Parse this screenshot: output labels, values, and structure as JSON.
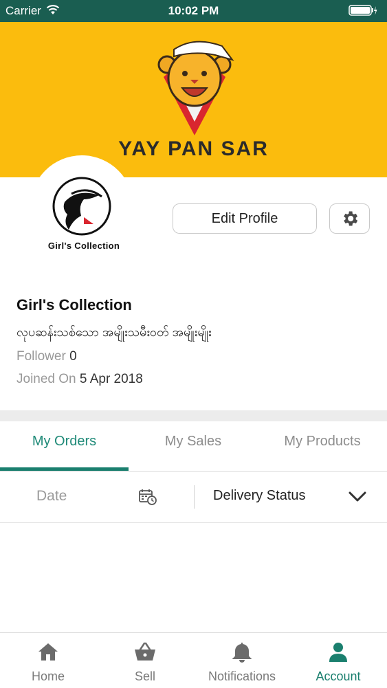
{
  "status_bar": {
    "carrier": "Carrier",
    "time": "10:02 PM"
  },
  "banner": {
    "brand": "YAY PAN SAR",
    "background": "#fbbc0d"
  },
  "profile": {
    "avatar_caption": "Girl's Collection",
    "edit_label": "Edit Profile",
    "shop_name": "Girl's Collection",
    "description": "လုပဆန်းသစ်သော အမျိုးသမီးဝတ် အမျိုးမျိုး",
    "follower_label": "Follower",
    "follower_count": "0",
    "joined_label": "Joined On",
    "joined_date": "5 Apr 2018"
  },
  "tabs": [
    {
      "label": "My Orders",
      "active": true
    },
    {
      "label": "My Sales",
      "active": false
    },
    {
      "label": "My Products",
      "active": false
    }
  ],
  "filter": {
    "date_label": "Date",
    "status_label": "Delivery Status"
  },
  "tabbar": [
    {
      "label": "Home",
      "icon": "home-icon"
    },
    {
      "label": "Sell",
      "icon": "basket-icon"
    },
    {
      "label": "Notifications",
      "icon": "bell-icon"
    },
    {
      "label": "Account",
      "icon": "user-icon",
      "active": true
    }
  ],
  "colors": {
    "accent": "#1a7f6e",
    "status_bar": "#1a5e51",
    "banner": "#fbbc0d"
  }
}
